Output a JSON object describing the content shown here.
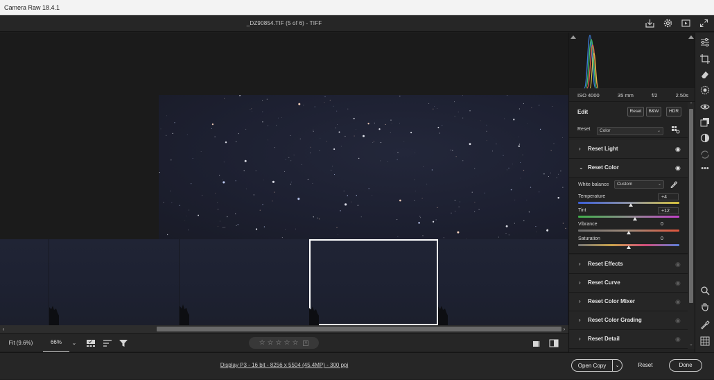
{
  "window": {
    "title": "Camera Raw 18.4.1"
  },
  "header": {
    "file_title": "_DZ90854.TIF (5 of 6)  -  TIFF",
    "icons": [
      "save-icon",
      "settings-icon",
      "slideshow-icon",
      "fullscreen-icon"
    ]
  },
  "bottom_toolbar": {
    "fit_label": "Fit (9.6%)",
    "zoom_label": "66%",
    "rating_stars": [
      "☆",
      "☆",
      "☆",
      "☆",
      "☆"
    ]
  },
  "status": {
    "info": "Display P3 - 16 bit - 8256 x 5504 (45.4MP) - 300 ppi",
    "open_copy": "Open Copy",
    "reset": "Reset",
    "done": "Done"
  },
  "exif": {
    "iso": "ISO 4000",
    "focal": "35 mm",
    "aperture": "f/2",
    "shutter": "2.50s"
  },
  "edit": {
    "title": "Edit",
    "buttons": {
      "reset": "Reset",
      "bw": "B&W",
      "hdr": "HDR"
    },
    "profile_label": "Reset",
    "profile_value": "Color"
  },
  "sections": {
    "light": "Reset Light",
    "color": "Reset Color",
    "effects": "Reset Effects",
    "curve": "Reset Curve",
    "mixer": "Reset Color Mixer",
    "grading": "Reset Color Grading",
    "detail": "Reset Detail"
  },
  "color": {
    "wb_label": "White balance",
    "wb_value": "Custom",
    "sliders": [
      {
        "label": "Temperature",
        "value": "+4",
        "position": 0.52
      },
      {
        "label": "Tint",
        "value": "+12",
        "position": 0.56
      },
      {
        "label": "Vibrance",
        "value": "0",
        "position": 0.5
      },
      {
        "label": "Saturation",
        "value": "0",
        "position": 0.5
      }
    ]
  },
  "colors": {
    "accent_border": "#ffffff",
    "panel_bg": "#232323",
    "canvas_bg": "#1b1b1b"
  }
}
